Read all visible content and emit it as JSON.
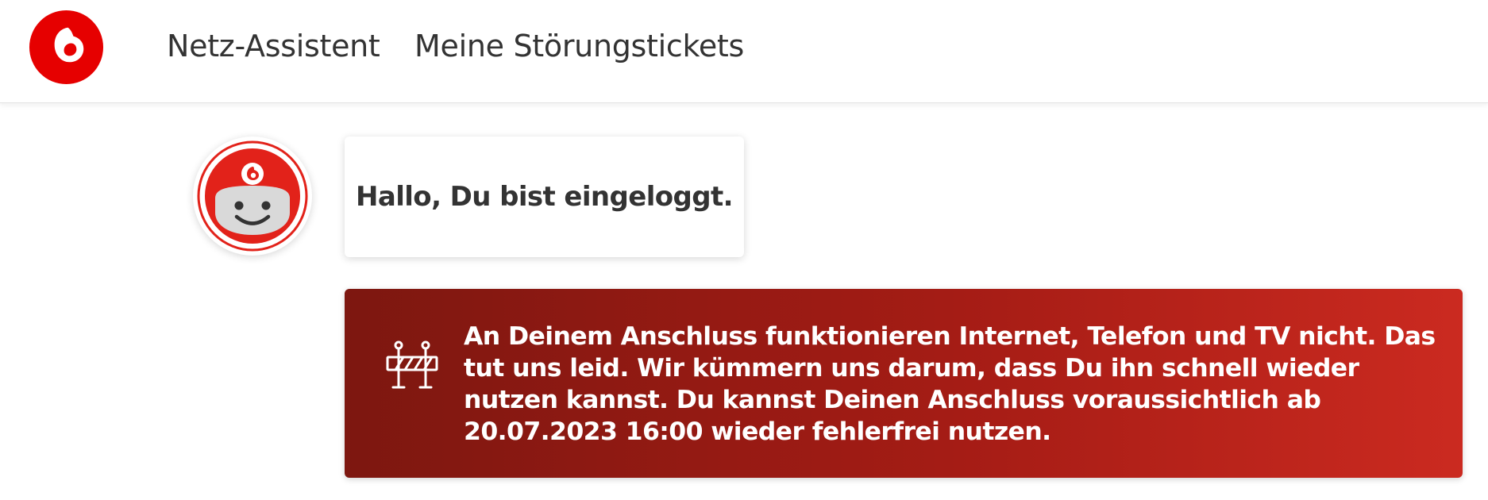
{
  "brand": {
    "logo_icon": "vodafone-logo-icon",
    "color": "#e60000"
  },
  "nav": {
    "items": [
      {
        "label": "Netz-Assistent"
      },
      {
        "label": "Meine Störungstickets"
      }
    ]
  },
  "chat": {
    "avatar_icon": "assistant-robot-avatar-icon",
    "greeting": "Hallo, Du bist eingeloggt."
  },
  "alert": {
    "icon": "road-barrier-icon",
    "message": "An Deinem Anschluss funktionieren Internet, Telefon und TV nicht. Das tut uns leid. Wir kümmern uns darum, dass Du ihn schnell wieder nutzen kannst. Du kannst Deinen Anschluss voraussichtlich ab 20.07.2023 16:00 wieder fehlerfrei nutzen.",
    "color_start": "#7d1710",
    "color_end": "#cb2a20"
  }
}
